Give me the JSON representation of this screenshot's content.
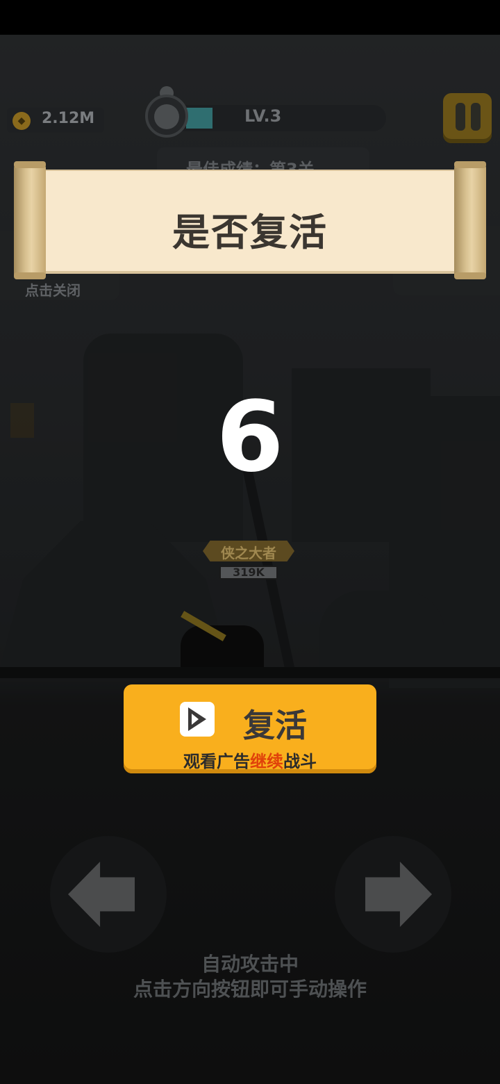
{
  "hud": {
    "coins": "2.12M",
    "level": "LV.3",
    "level_progress": 0.13,
    "best_record": "最佳成绩：第3关"
  },
  "left_tab": {
    "close_hint": "点击关闭"
  },
  "dialog": {
    "title": "是否复活",
    "countdown": "6"
  },
  "boss": {
    "name": "侠之大者",
    "hp": "319K"
  },
  "revive_button": {
    "label": "复活",
    "sub_prefix": "观看广告",
    "sub_highlight": "继续",
    "sub_suffix": "战斗"
  },
  "hint": {
    "line1": "自动攻击中",
    "line2": "点击方向按钮即可手动操作"
  },
  "colors": {
    "button": "#f9af1d",
    "highlight": "#e0420a",
    "scroll": "#f8e8cc",
    "countdown": "#ffffff"
  },
  "icons": [
    "coin-icon",
    "pause-icon",
    "play-icon",
    "arrow-left-icon",
    "arrow-right-icon",
    "avatar-icon"
  ]
}
